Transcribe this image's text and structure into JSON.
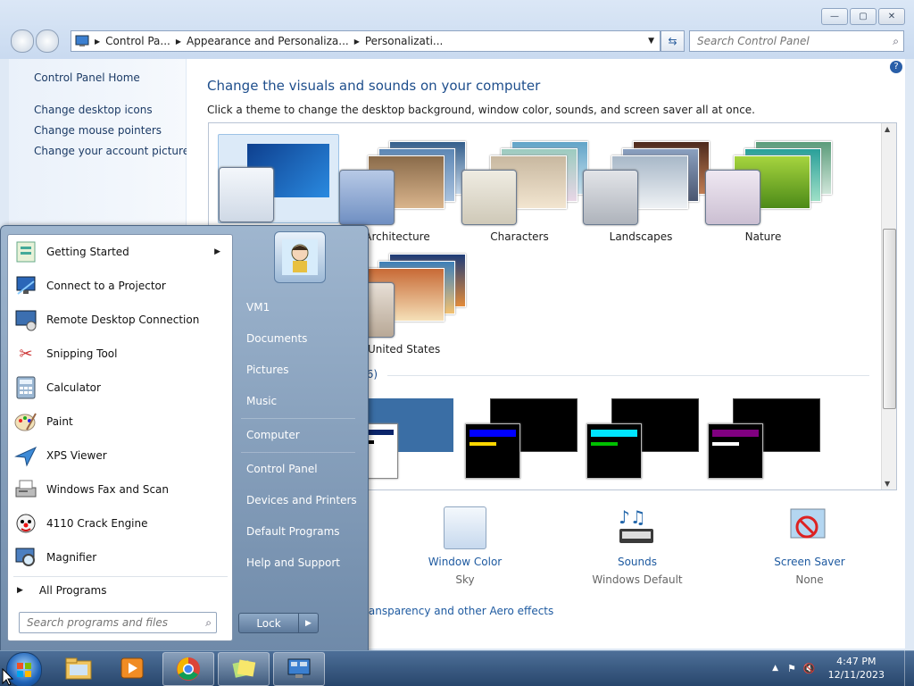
{
  "window": {
    "address": [
      "Control Pa...",
      "Appearance and Personaliza...",
      "Personalizati..."
    ],
    "search_placeholder": "Search Control Panel",
    "help_label": "?"
  },
  "left_nav": {
    "home": "Control Panel Home",
    "links": [
      "Change desktop icons",
      "Change mouse pointers",
      "Change your account picture"
    ]
  },
  "main": {
    "title": "Change the visuals and sounds on your computer",
    "subtitle": "Click a theme to change the desktop background, window color, sounds, and screen saver all at once.",
    "themes": [
      "Architecture",
      "Characters",
      "Landscapes",
      "Nature",
      "United States"
    ],
    "basic_header_fragment": "s (6)",
    "bottom": {
      "window_color_label": "Window Color",
      "window_color_value": "Sky",
      "sounds_label": "Sounds",
      "sounds_value": "Windows Default",
      "screensaver_label": "Screen Saver",
      "screensaver_value": "None",
      "aero_link": "ransparency and other Aero effects"
    }
  },
  "start_menu": {
    "programs": [
      {
        "label": "Getting Started",
        "icon": "getting-started-icon",
        "has_arrow": true
      },
      {
        "label": "Connect to a Projector",
        "icon": "projector-icon"
      },
      {
        "label": "Remote Desktop Connection",
        "icon": "remote-desktop-icon"
      },
      {
        "label": "Snipping Tool",
        "icon": "scissors-icon"
      },
      {
        "label": "Calculator",
        "icon": "calculator-icon"
      },
      {
        "label": "Paint",
        "icon": "paint-icon"
      },
      {
        "label": "XPS Viewer",
        "icon": "xps-viewer-icon"
      },
      {
        "label": "Windows Fax and Scan",
        "icon": "fax-icon"
      },
      {
        "label": "4110 Crack Engine",
        "icon": "clown-icon"
      },
      {
        "label": "Magnifier",
        "icon": "magnifier-icon"
      }
    ],
    "all_programs": "All Programs",
    "search_placeholder": "Search programs and files",
    "right_items": [
      "VM1",
      "Documents",
      "Pictures",
      "Music",
      "Computer",
      "Control Panel",
      "Devices and Printers",
      "Default Programs",
      "Help and Support"
    ],
    "lock_label": "Lock"
  },
  "taskbar": {
    "time": "4:47 PM",
    "date": "12/11/2023"
  }
}
